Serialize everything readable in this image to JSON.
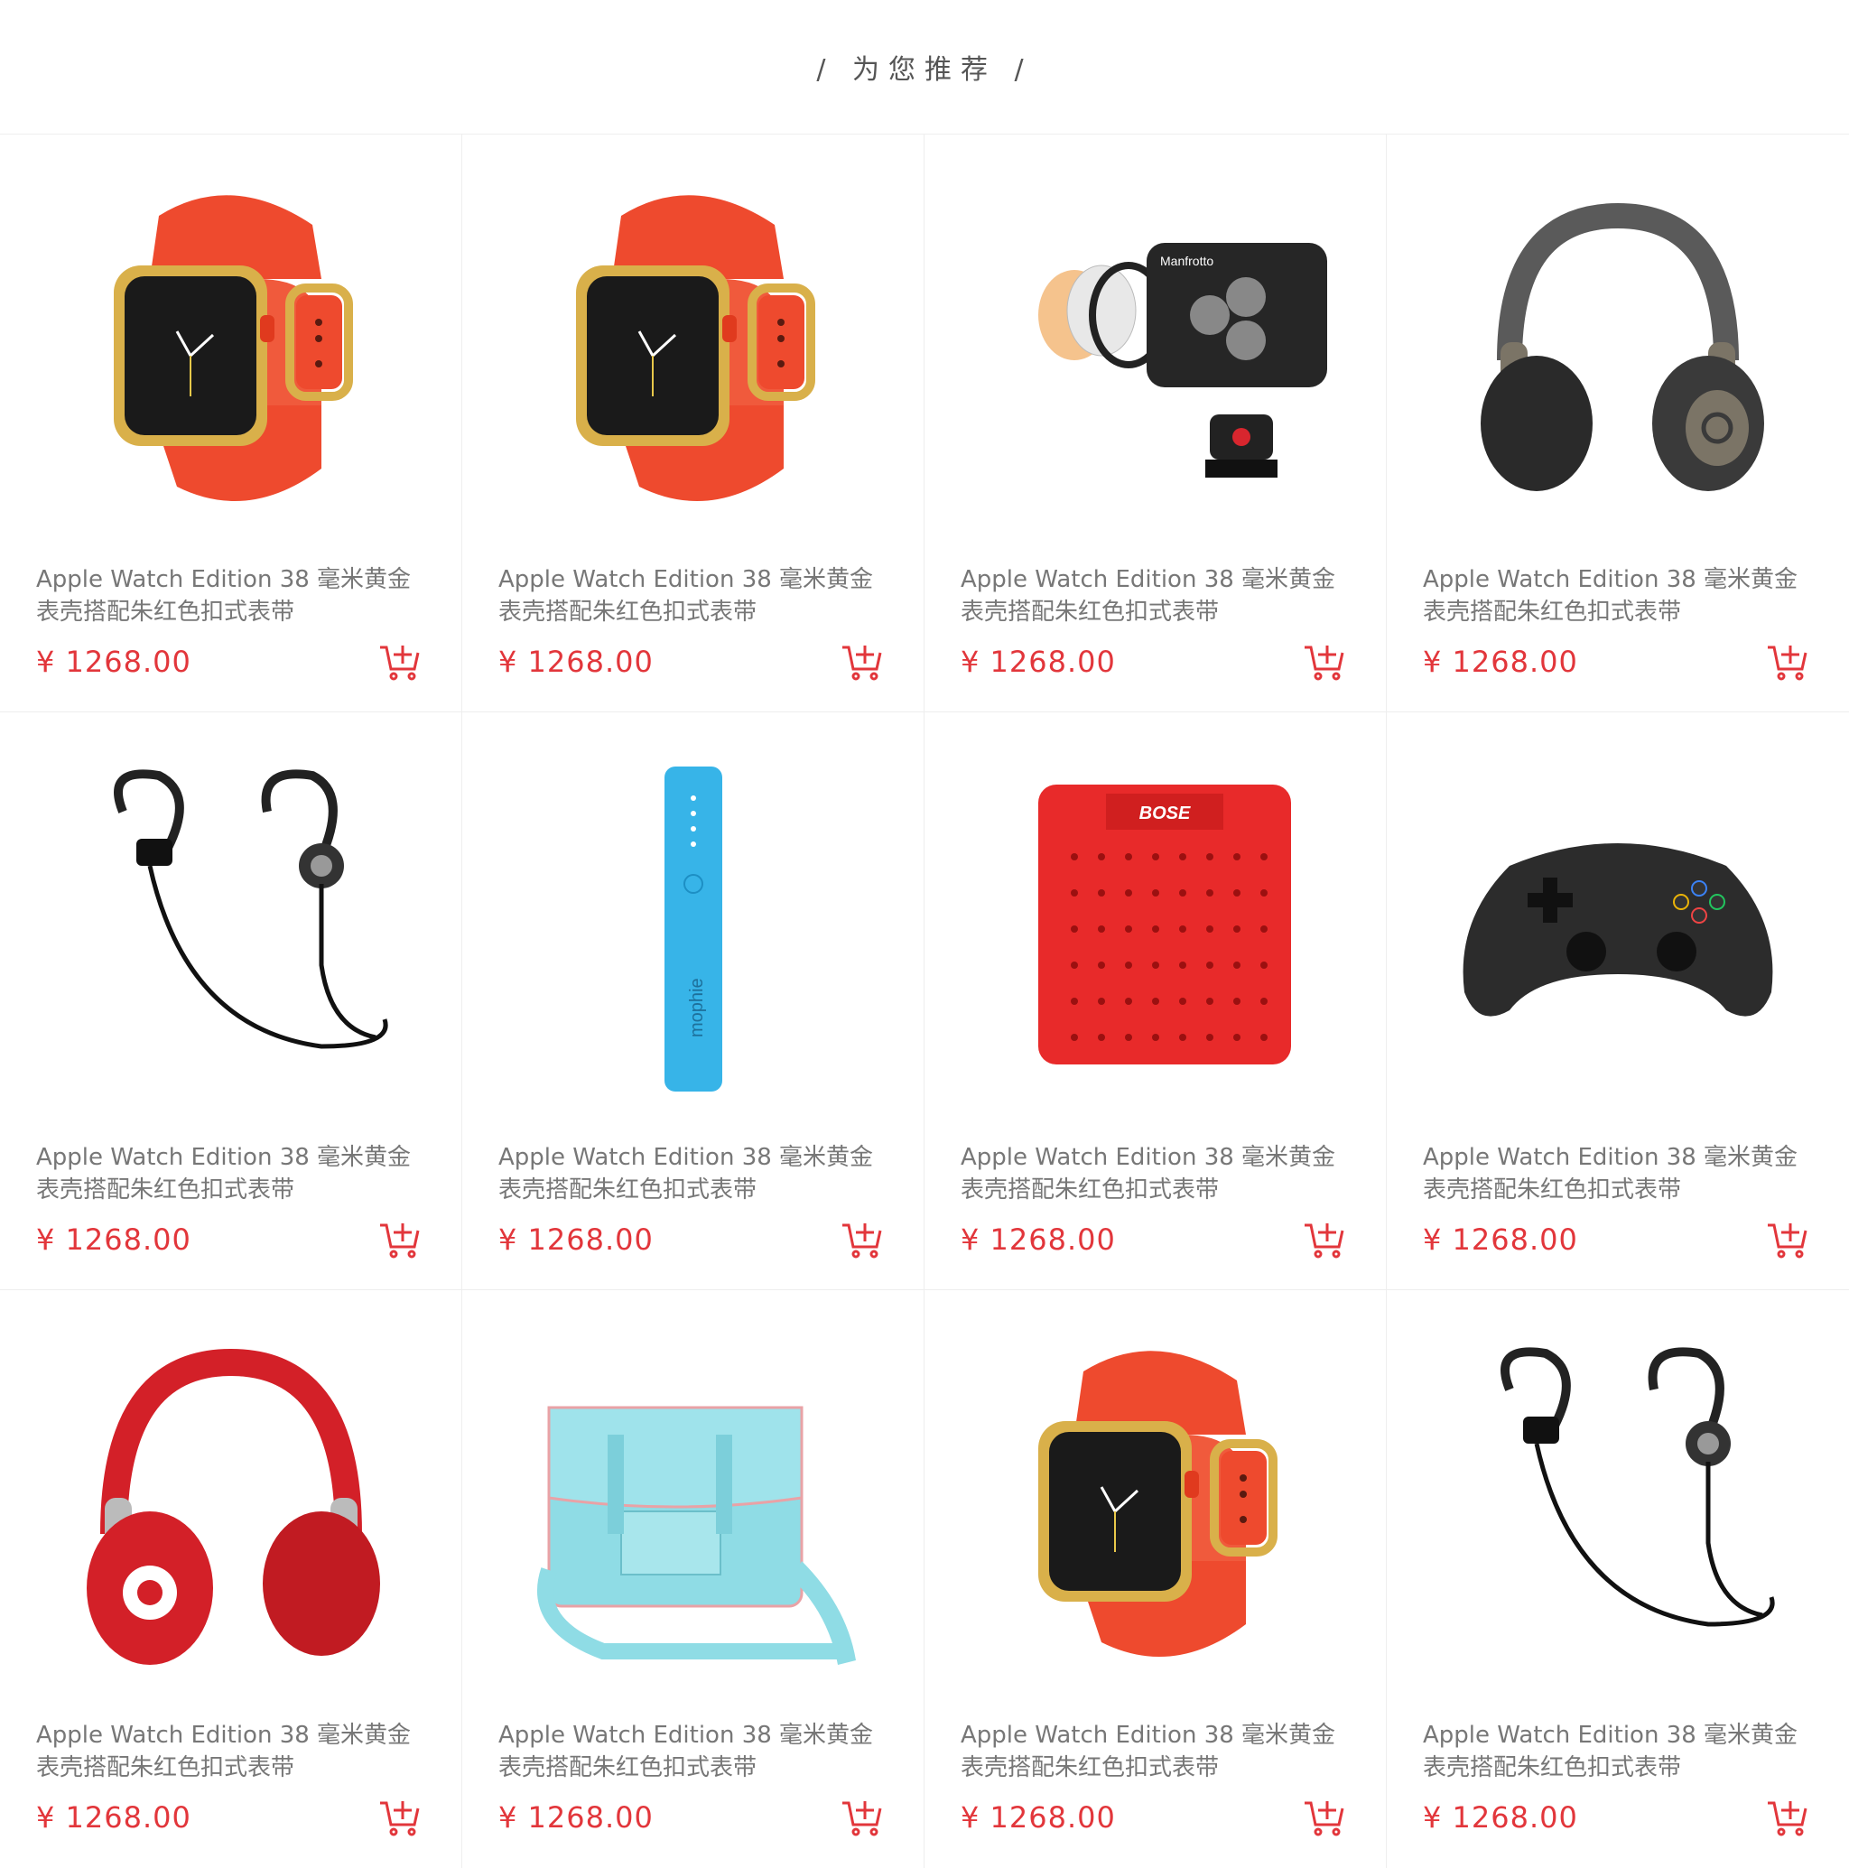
{
  "header": {
    "title": "/ 为您推荐 /"
  },
  "accent_color": "#e2363b",
  "products": [
    {
      "image": "apple-watch-red-band",
      "name": "Apple Watch Edition 38 毫米黄金表壳搭配朱红色扣式表带",
      "price": "¥ 1268.00"
    },
    {
      "image": "apple-watch-red-band",
      "name": "Apple Watch Edition 38 毫米黄金表壳搭配朱红色扣式表带",
      "price": "¥ 1268.00"
    },
    {
      "image": "manfrotto-led-light",
      "name": "Apple Watch Edition 38 毫米黄金表壳搭配朱红色扣式表带",
      "price": "¥ 1268.00"
    },
    {
      "image": "beats-headphones-gray",
      "name": "Apple Watch Edition 38 毫米黄金表壳搭配朱红色扣式表带",
      "price": "¥ 1268.00"
    },
    {
      "image": "beats-earphones-black",
      "name": "Apple Watch Edition 38 毫米黄金表壳搭配朱红色扣式表带",
      "price": "¥ 1268.00"
    },
    {
      "image": "mophie-power-bank-blue",
      "name": "Apple Watch Edition 38 毫米黄金表壳搭配朱红色扣式表带",
      "price": "¥ 1268.00"
    },
    {
      "image": "bose-speaker-red",
      "name": "Apple Watch Edition 38 毫米黄金表壳搭配朱红色扣式表带",
      "price": "¥ 1268.00"
    },
    {
      "image": "steelseries-game-controller",
      "name": "Apple Watch Edition 38 毫米黄金表壳搭配朱红色扣式表带",
      "price": "¥ 1268.00"
    },
    {
      "image": "beats-headphones-red",
      "name": "Apple Watch Edition 38 毫米黄金表壳搭配朱红色扣式表带",
      "price": "¥ 1268.00"
    },
    {
      "image": "satchel-bag-turquoise",
      "name": "Apple Watch Edition 38 毫米黄金表壳搭配朱红色扣式表带",
      "price": "¥ 1268.00"
    },
    {
      "image": "apple-watch-red-band",
      "name": "Apple Watch Edition 38 毫米黄金表壳搭配朱红色扣式表带",
      "price": "¥ 1268.00"
    },
    {
      "image": "beats-earphones-black",
      "name": "Apple Watch Edition 38 毫米黄金表壳搭配朱红色扣式表带",
      "price": "¥ 1268.00"
    }
  ]
}
